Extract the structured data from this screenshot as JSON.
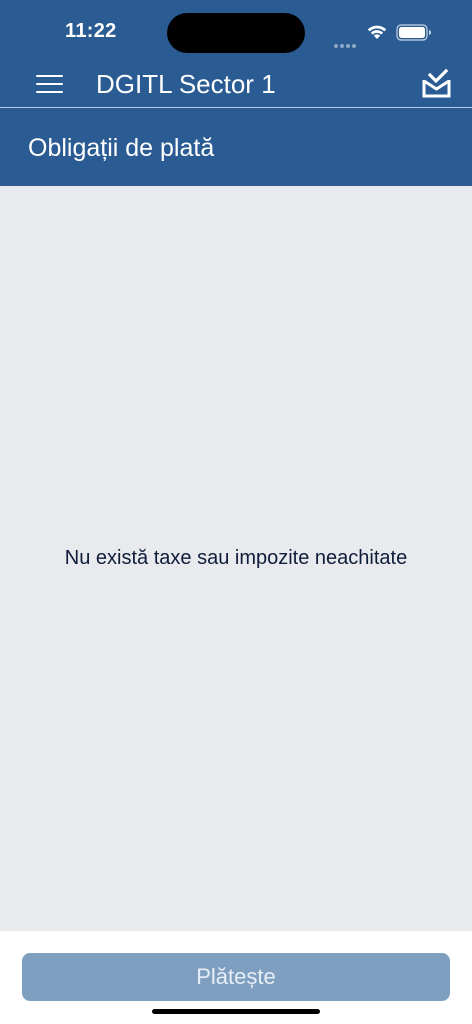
{
  "status_bar": {
    "time": "11:22"
  },
  "header": {
    "app_title": "DGITL Sector 1",
    "menu_icon": "menu-icon",
    "inbox_icon": "inbox-check-icon",
    "section_title": "Obligații de plată"
  },
  "content": {
    "empty_message": "Nu există taxe sau impozite neachitate"
  },
  "footer": {
    "pay_button_label": "Plătește"
  },
  "colors": {
    "header_bg": "#2a5b92",
    "content_bg": "#e9eaee",
    "button_bg": "#7f9fc0"
  }
}
